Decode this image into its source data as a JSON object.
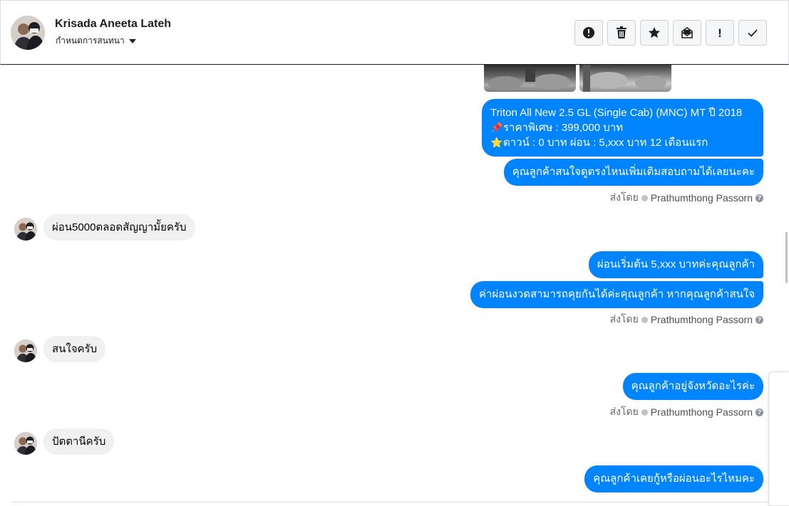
{
  "header": {
    "contact_name": "Krisada Aneeta Lateh",
    "assign_label": "กำหนดการสนทนา",
    "toolbar": [
      {
        "icon": "alert-circle-icon",
        "label": "Mark as spam"
      },
      {
        "icon": "trash-icon",
        "label": "Delete"
      },
      {
        "icon": "star-icon",
        "label": "Star"
      },
      {
        "icon": "mark-unread-icon",
        "label": "Mark as unread"
      },
      {
        "icon": "exclamation-icon",
        "label": "Follow up"
      },
      {
        "icon": "checkmark-icon",
        "label": "Mark as done"
      }
    ]
  },
  "thread": {
    "product_message": {
      "line1": "Triton All New 2.5 GL (Single Cab) (MNC) MT ปี 2018",
      "line2_emoji": "📌",
      "line2": "ราคาพิเศษ : 399,000 บาท",
      "line3_emoji": "⭐",
      "line3": "ดาวน์ : 0 บาท ผ่อน : 5,xxx บาท 12 เดือนแรก"
    },
    "msg_followup_1": "คุณลูกค้าสนใจดูตรงไหนเพิ่มเติมสอบถามได้เลยนะคะ",
    "sent_by_label": "ส่งโดย",
    "agent_name": "Prathumthong Passorn",
    "msg_in_1": "ผ่อน5000ตลอดสัญญามั้ยครับ",
    "msg_out_2": "ผ่อนเริ่มต้น 5,xxx บาทค่ะคุณลูกค้า",
    "msg_out_3": "ค่าผ่อนงวดสามารถคุยกันได้ค่ะคุณลูกค้า หากคุณลูกค้าสนใจ",
    "msg_in_2": "สนใจครับ",
    "msg_out_4": "คุณลูกค้าอยู่จังหวัดอะไรค่ะ",
    "msg_in_3": "ปัตตานีครับ",
    "msg_out_5": "คุณลูกค้าเคยกู้หรือผ่อนอะไรไหมคะ",
    "help_icon": "?"
  },
  "colors": {
    "outgoing_bubble": "#0084ff",
    "incoming_bubble": "#f0f0f0",
    "secondary_text": "#65676b"
  }
}
